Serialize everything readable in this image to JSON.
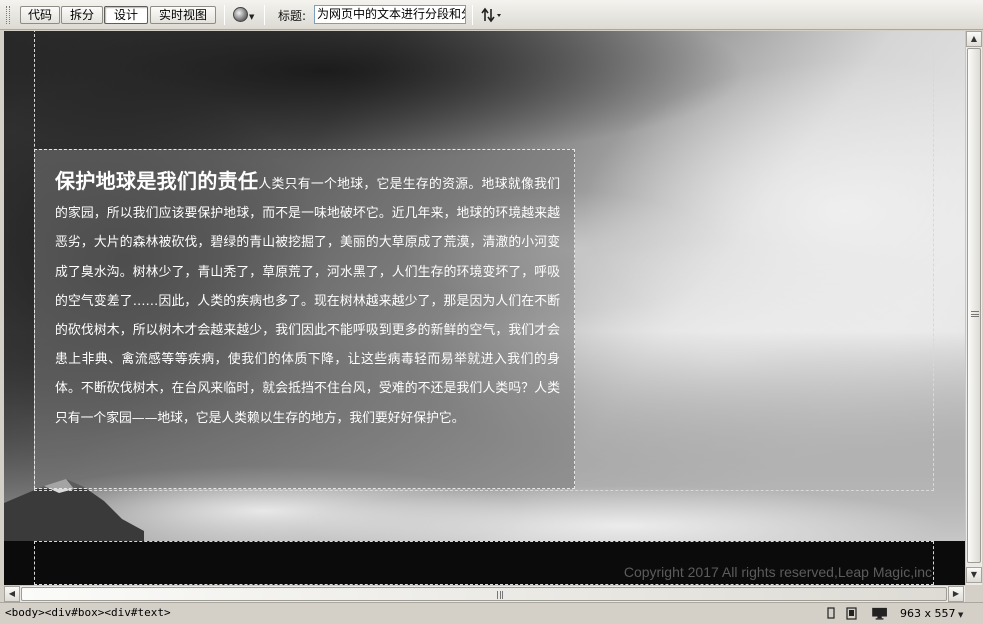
{
  "toolbar": {
    "code_label": "代码",
    "split_label": "拆分",
    "design_label": "设计",
    "live_view_label": "实时视图",
    "title_label": "标题:",
    "title_value": "为网页中的文本进行分段和分"
  },
  "content": {
    "heading": "保护地球是我们的责任",
    "body": "人类只有一个地球，它是生存的资源。地球就像我们的家园，所以我们应该要保护地球，而不是一味地破坏它。近几年来，地球的环境越来越恶劣，大片的森林被砍伐，碧绿的青山被挖掘了，美丽的大草原成了荒漠，清澈的小河变成了臭水沟。树林少了，青山秃了，草原荒了，河水黑了，人们生存的环境变坏了，呼吸的空气变差了……因此，人类的疾病也多了。现在树林越来越少了，那是因为人们在不断的砍伐树木，所以树木才会越来越少，我们因此不能呼吸到更多的新鲜的空气，我们才会患上非典、禽流感等等疾病，使我们的体质下降，让这些病毒轻而易举就进入我们的身体。不断砍伐树木，在台风来临时，就会抵挡不住台风，受难的不还是我们人类吗？人类只有一个家园——地球，它是人类赖以生存的地方，我们要好好保护它。",
    "copyright": "Copyright 2017 All rights reserved,Leap Magic,inc"
  },
  "statusbar": {
    "tag_selector": "<body><div#box><div#text>",
    "window_size": "963 x 557"
  },
  "icons": {
    "globe": "globe-icon",
    "refresh": "refresh-icon",
    "select": "select-tool-icon",
    "hand": "hand-tool-icon",
    "zoom": "zoom-tool-icon"
  }
}
